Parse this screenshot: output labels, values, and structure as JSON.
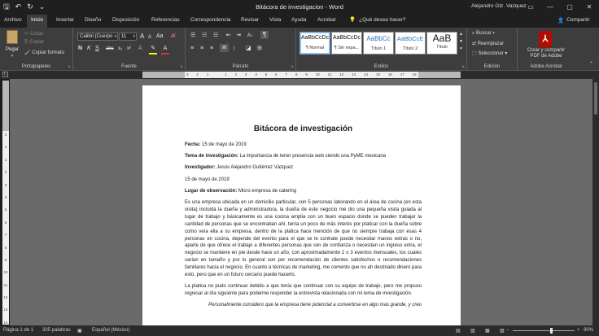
{
  "window": {
    "title": "Bitácora de investigacion  -  Word",
    "user": "Alejandro Gtz. Vazquez",
    "controls": [
      "▭",
      "—",
      "▢",
      "✕"
    ]
  },
  "tabs": {
    "items": [
      "Archivo",
      "Inicio",
      "Insertar",
      "Diseño",
      "Disposición",
      "Referencias",
      "Correspondencia",
      "Revisar",
      "Vista",
      "Ayuda",
      "Acrobat"
    ],
    "active": "Inicio",
    "tell_me": "¿Qué desea hacer?",
    "share": "Compartir"
  },
  "ribbon": {
    "clipboard": {
      "label": "Portapapeles",
      "paste": "Pegar",
      "cut": "Cortar",
      "copy": "Copiar",
      "format_painter": "Copiar formato"
    },
    "font": {
      "label": "Fuente",
      "font_name": "Calibri (Cuerpo",
      "font_size": "11",
      "bold": "N",
      "italic": "K",
      "underline": "S",
      "grow": "A",
      "shrink": "A",
      "case": "Aa",
      "strikethrough": "abc",
      "subscript": "x₂",
      "superscript": "x²",
      "font_color": "A"
    },
    "paragraph": {
      "label": "Párrafo",
      "show_marks": "¶"
    },
    "styles": {
      "label": "Estilos",
      "items": [
        {
          "sample": "AaBbCcDc",
          "name": "¶ Normal"
        },
        {
          "sample": "AaBbCcDc",
          "name": "¶ Sin espa..."
        },
        {
          "sample": "AaBbCc",
          "name": "Título 1"
        },
        {
          "sample": "AaBbCcE",
          "name": "Título 2"
        },
        {
          "sample": "AaB",
          "name": "Título"
        }
      ]
    },
    "editing": {
      "label": "Edición",
      "find": "Buscar",
      "replace": "Reemplazar",
      "select": "Seleccionar"
    },
    "acrobat": {
      "label": "Adobe Acrobat",
      "create_line1": "Crear y compartir",
      "create_line2": "PDF de Adobe"
    }
  },
  "ruler": {
    "h_numbers": [
      "3",
      "2",
      "1",
      "",
      "1",
      "2",
      "3",
      "4",
      "5",
      "6",
      "7",
      "8",
      "9",
      "10",
      "11",
      "12",
      "13",
      "14",
      "15",
      "16",
      "17",
      "18"
    ],
    "v_numbers": [
      "2",
      "1",
      "1",
      "2",
      "3",
      "4",
      "5",
      "6",
      "7",
      "8",
      "9",
      "10",
      "11",
      "12",
      "13",
      "14"
    ]
  },
  "document": {
    "heading": "Bitácora de investigación",
    "fields": [
      {
        "label": "Fecha:",
        "value": " 15 de mayo de 2019"
      },
      {
        "label": "Tema de investigación:",
        "value": " La importancia de tener presencia web siendo una PyME mexicana"
      },
      {
        "label": "Investigador:",
        "value": " Jesús Alejandro Gutiérrez Vázquez"
      },
      {
        "label": "",
        "value": "15 de mayo de 2019"
      },
      {
        "label": "Lugar de observación:",
        "value": " Micro empresa de catering"
      }
    ],
    "paragraphs": [
      "Es una empresa ubicada en un domicilio particular, con 5 personas laborando en el área de cocina (en esta visita) incluida la dueña y administradora, la dueña de este negocio me dio una pequeña visita guiada al lugar de trabajo y básicamente es una cocina amplia con un buen espacio donde se pueden trabajar la cantidad de personas que se encontraban ahí, tenía un poco de más interés por platicar con la dueña sobre como veía ella a su empresa, dentro de la plática hace mención de que no siempre trabaja con esas 4 personas en cocina, depende del evento para el que se le contrate puede necesitar manos extras o no, aparte de que ofrece el trabajo a diferentes personas que son de confianza o necesitan un ingreso extra, el negocio se mantiene en pie desde hace un año, con aproximadamente 2 o 3 eventos mensuales, los cuales varían en tamaño y por lo general son por recomendación de clientes satisfechos o recomendaciones familiares hacia el negocio. En cuanto a técnicas de marketing, me comento que no ah destinado dinero para esto, pero que en un futuro cercano puede hacerlo.",
      "La platica no pudo continuar debido a que tenía que continuar con su equipo de trabajo, pero me propuso regresar al día siguiente para poderme responder la entrevista relacionada con mi tema de investigación."
    ],
    "quote": "Personalmente considero que la empresa tiene potencial a convertirse en algo mas grande, y creo"
  },
  "status": {
    "page": "Página 1 de 1",
    "words": "305 palabras",
    "language": "Español (México)",
    "zoom": "90%",
    "zoom_minus": "−",
    "zoom_plus": "+"
  }
}
